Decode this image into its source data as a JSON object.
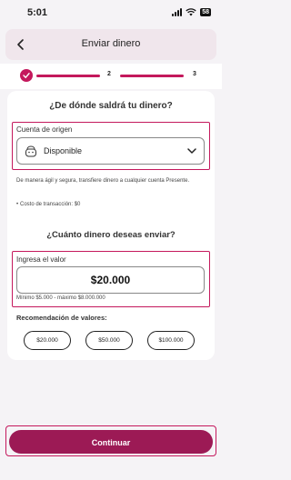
{
  "status_bar": {
    "time": "5:01",
    "battery": "58"
  },
  "header": {
    "title": "Enviar dinero"
  },
  "stepper": {
    "step2": "2",
    "step3": "3"
  },
  "origin": {
    "question": "¿De dónde saldrá tu dinero?",
    "label": "Cuenta de origen",
    "value": "Disponible",
    "description": "De manera ágil y segura, transfiere dinero a cualquier cuenta Presente.",
    "fee": "Costo de transacción: $0"
  },
  "amount": {
    "question": "¿Cuánto dinero deseas enviar?",
    "label": "Ingresa el valor",
    "value": "$20.000",
    "hint": "Mínimo $5.000 - máximo $8.000.000"
  },
  "recommendations": {
    "label": "Recomendación de valores:",
    "options": [
      "$20.000",
      "$50.000",
      "$100.000"
    ]
  },
  "footer": {
    "continue_label": "Continuar"
  },
  "colors": {
    "accent": "#c4185c",
    "button": "#9c1a55",
    "header_bg": "#f0e6ec"
  }
}
